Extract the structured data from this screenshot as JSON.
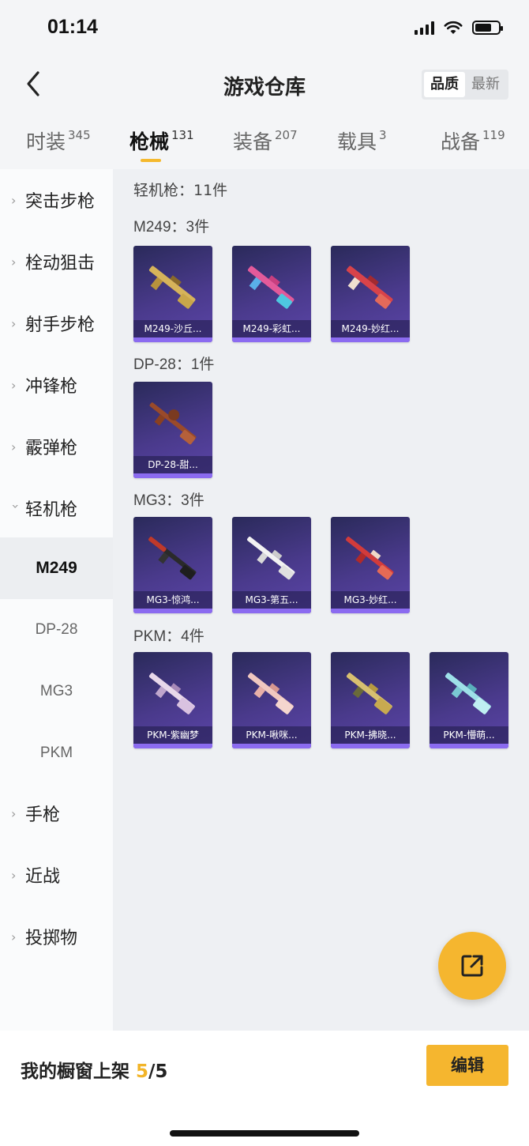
{
  "status": {
    "time": "01:14"
  },
  "nav": {
    "title": "游戏仓库",
    "sort_quality": "品质",
    "sort_latest": "最新"
  },
  "tabs": [
    {
      "label": "时装",
      "count": "345"
    },
    {
      "label": "枪械",
      "count": "131"
    },
    {
      "label": "装备",
      "count": "207"
    },
    {
      "label": "载具",
      "count": "3"
    },
    {
      "label": "战备",
      "count": "119"
    }
  ],
  "sidebar": {
    "items": [
      {
        "label": "突击步枪"
      },
      {
        "label": "栓动狙击"
      },
      {
        "label": "射手步枪"
      },
      {
        "label": "冲锋枪"
      },
      {
        "label": "霰弹枪"
      },
      {
        "label": "轻机枪"
      }
    ],
    "subitems": [
      {
        "label": "M249"
      },
      {
        "label": "DP-28"
      },
      {
        "label": "MG3"
      },
      {
        "label": "PKM"
      }
    ],
    "more": [
      {
        "label": "手枪"
      },
      {
        "label": "近战"
      },
      {
        "label": "投掷物"
      }
    ]
  },
  "main": {
    "total": "轻机枪：11件",
    "groups": [
      {
        "title": "M249：3件",
        "cards": [
          "M249-沙丘...",
          "M249-彩虹...",
          "M249-妙红..."
        ]
      },
      {
        "title": "DP-28：1件",
        "cards": [
          "DP-28-甜..."
        ]
      },
      {
        "title": "MG3：3件",
        "cards": [
          "MG3-惊鸿...",
          "MG3-第五...",
          "MG3-妙红..."
        ]
      },
      {
        "title": "PKM：4件",
        "cards": [
          "PKM-紫幽梦",
          "PKM-啾咪...",
          "PKM-拂晓...",
          "PKM-懵萌..."
        ]
      }
    ]
  },
  "bottom": {
    "shelf_label": "我的橱窗上架 ",
    "shelf_current": "5",
    "shelf_total": "/5",
    "edit_label": "编辑"
  },
  "colors": {
    "accent": "#f5b62f",
    "card_top": "#2a2a5a",
    "card_bottom": "#5b45a8"
  }
}
